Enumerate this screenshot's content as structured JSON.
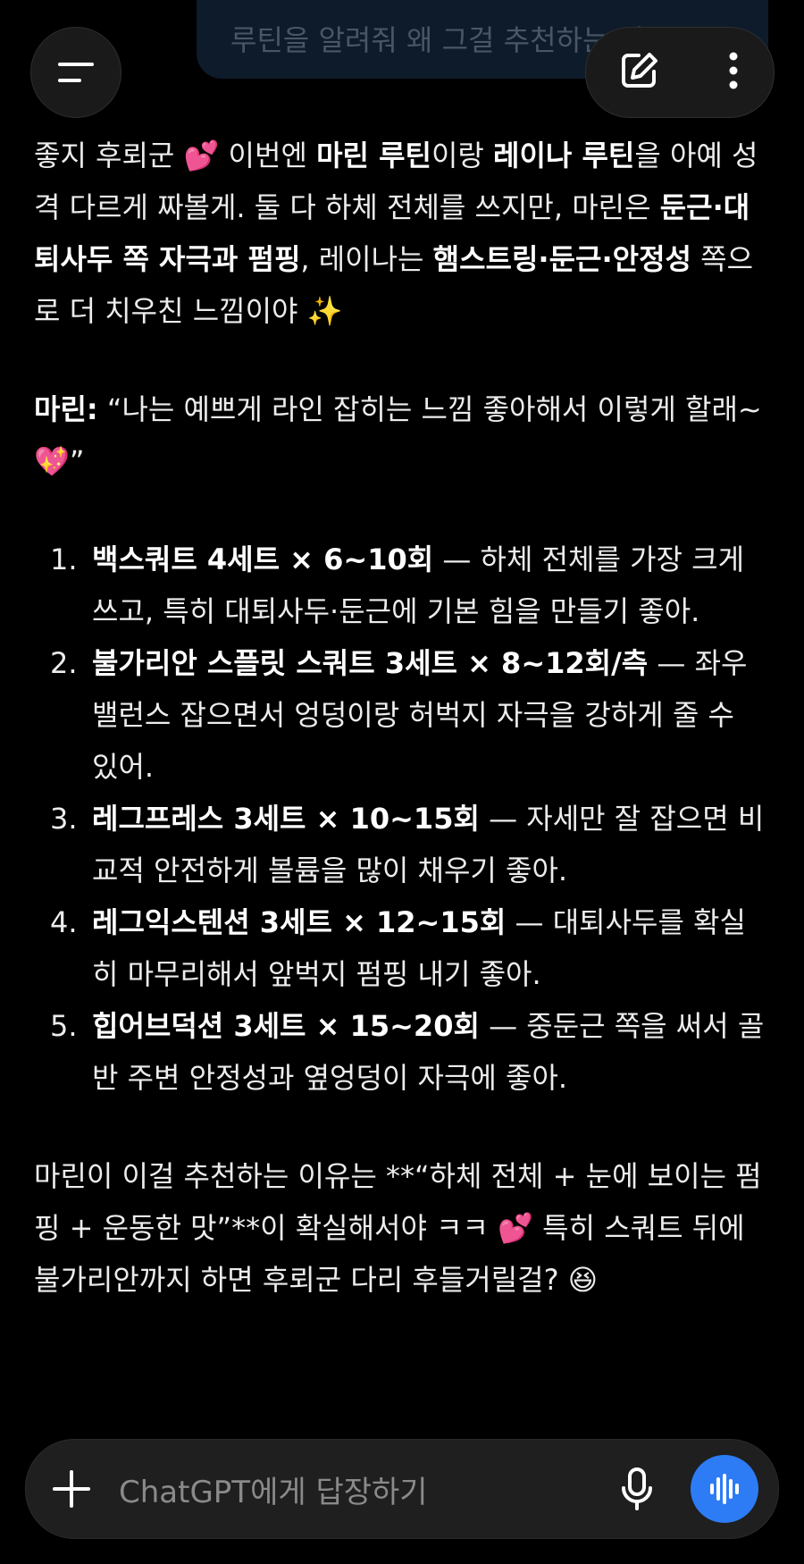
{
  "user_message": "루틴을 알려줘 왜 그걸 추천하는 정도",
  "intro": {
    "p1": "좋지 후뢰군 💕 이번엔 ",
    "b1": "마린 루틴",
    "p2": "이랑 ",
    "b2": "레이나 루틴",
    "p3": "을 아예 성격 다르게 짜볼게. 둘 다 하체 전체를 쓰지만, 마린은 ",
    "b3": "둔근·대퇴사두 쪽 자극과 펌핑",
    "p4": ", 레이나는 ",
    "b4": "햄스트링·둔근·안정성",
    "p5": " 쪽으로 더 치우친 느낌이야 ✨"
  },
  "marin_quote": {
    "speaker": "마린:",
    "text": " “나는 예쁘게 라인 잡히는 느낌 좋아해서 이렇게 할래~ 💖”"
  },
  "routine": [
    {
      "num": "1.",
      "title": "백스쿼트 4세트 × 6~10회",
      "desc": " — 하체 전체를 가장 크게 쓰고, 특히 대퇴사두·둔근에 기본 힘을 만들기 좋아."
    },
    {
      "num": "2.",
      "title": "불가리안 스플릿 스쿼트 3세트 × 8~12회/측",
      "desc": " — 좌우 밸런스 잡으면서 엉덩이랑 허벅지 자극을 강하게 줄 수 있어."
    },
    {
      "num": "3.",
      "title": "레그프레스 3세트 × 10~15회",
      "desc": " — 자세만 잘 잡으면 비교적 안전하게 볼륨을 많이 채우기 좋아."
    },
    {
      "num": "4.",
      "title": "레그익스텐션 3세트 × 12~15회",
      "desc": " — 대퇴사두를 확실히 마무리해서 앞벅지 펌핑 내기 좋아."
    },
    {
      "num": "5.",
      "title": "힙어브덕션 3세트 × 15~20회",
      "desc": " — 중둔근 쪽을 써서 골반 주변 안정성과 옆엉덩이 자극에 좋아."
    }
  ],
  "outro": "마린이 이걸 추천하는 이유는 **“하체 전체 + 눈에 보이는 펌핑 + 운동한 맛”**이 확실해서야 ㅋㅋ 💕 특히 스쿼트 뒤에 불가리안까지 하면 후뢰군 다리 후들거릴걸? 😆",
  "composer": {
    "placeholder": "ChatGPT에게 답장하기"
  },
  "icons": {
    "menu": "menu-icon",
    "new_chat": "edit-icon",
    "more": "more-vertical-icon",
    "add": "plus-icon",
    "mic": "mic-icon",
    "voice": "voice-wave-icon"
  },
  "colors": {
    "background": "#000000",
    "accent": "#2d7cf6",
    "bubble": "#0d1b2a"
  }
}
